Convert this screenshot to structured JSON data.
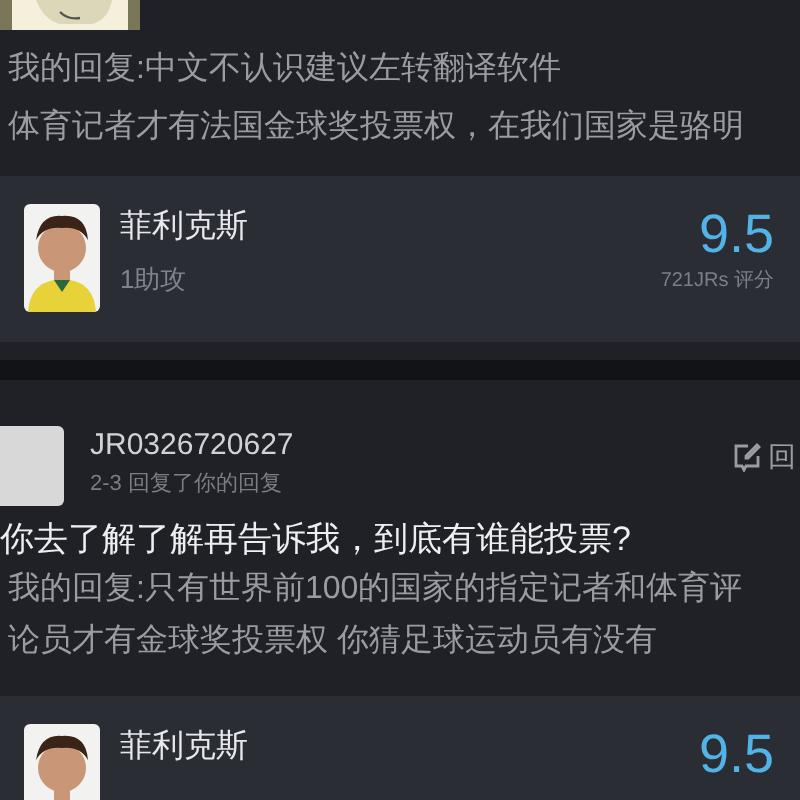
{
  "top_comment": {
    "reply_lines": [
      "我的回复:中文不认识建议左转翻译软件",
      "体育记者才有法国金球奖投票权，在我们国家是骆明"
    ]
  },
  "player_card": {
    "name": "菲利克斯",
    "stat": "1助攻",
    "score": "9.5",
    "score_caption": "721JRs 评分"
  },
  "comment": {
    "username": "JR0326720627",
    "meta": "2-3 回复了你的回复",
    "reply_button": "回",
    "text": "你去了解了解再告诉我，到底有谁能投票?",
    "quote": "我的回复:只有世界前100的国家的指定记者和体育评论员才有金球奖投票权 你猜足球运动员有没有"
  },
  "player_card_2": {
    "name": "菲利克斯",
    "score": "9.5"
  }
}
